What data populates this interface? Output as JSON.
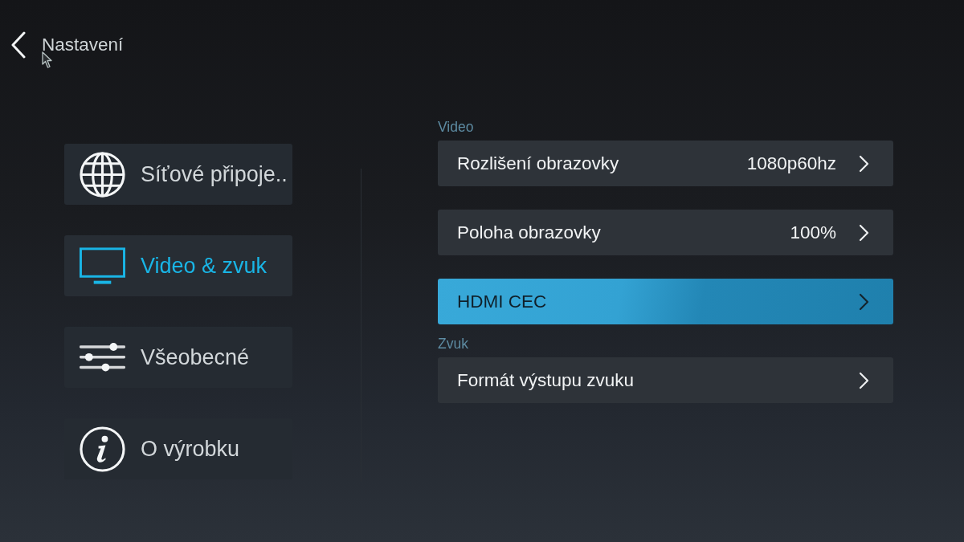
{
  "header": {
    "title": "Nastavení"
  },
  "menu": [
    {
      "kind": "network",
      "label": "Síťové připoje..",
      "selected": false
    },
    {
      "kind": "display",
      "label": "Video & zvuk",
      "selected": true
    },
    {
      "kind": "general",
      "label": "Všeobecné",
      "selected": false
    },
    {
      "kind": "info",
      "label": "O výrobku",
      "selected": false
    }
  ],
  "sections": [
    {
      "title": "Video",
      "items": [
        {
          "label": "Rozlišení obrazovky",
          "value": "1080p60hz",
          "selected": false
        },
        {
          "label": "Poloha obrazovky",
          "value": "100%",
          "selected": false
        },
        {
          "label": "HDMI CEC",
          "selected": true
        }
      ]
    },
    {
      "title": "Zvuk",
      "items": [
        {
          "label": "Formát výstupu zvuku",
          "selected": false
        }
      ]
    }
  ]
}
